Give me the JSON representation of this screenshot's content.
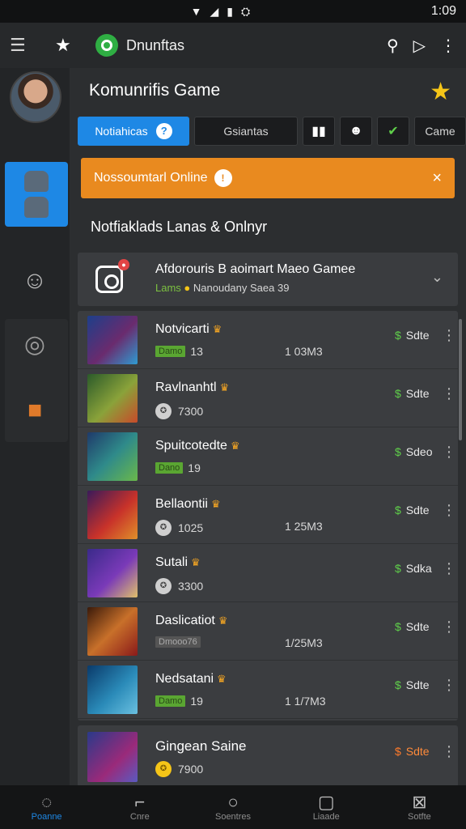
{
  "statusbar": {
    "time": "1:09"
  },
  "topbar": {
    "title": "Dnunftas"
  },
  "main": {
    "title": "Komunrifis Game",
    "tabs": [
      {
        "label": "Notiahicas"
      },
      {
        "label": "Gsiantas"
      },
      {
        "label": "Came"
      }
    ],
    "banner": {
      "text": "Nossoumtarl Online",
      "close": "×"
    },
    "section_title": "Notfiaklads Lanas & Onlnyr",
    "featured": {
      "title": "Afdorouris B aoimart Maeo Gamee",
      "sub_tag": "Lams",
      "sub_text": "Nanoudany Saea 39"
    },
    "games": [
      {
        "name": "Notvicarti",
        "tag": "Damo",
        "value": "13",
        "size": "1 03M3",
        "status": "Sdte",
        "thumb": "linear-gradient(135deg,#1d3f8a,#6a2b6e 55%,#2f9bd1)"
      },
      {
        "name": "Ravlnanhtl",
        "tag": "",
        "value": "7300",
        "size": "",
        "status": "Sdte",
        "thumb": "linear-gradient(135deg,#2b5a2a,#8aa23a 55%,#c84a2a)"
      },
      {
        "name": "Spuitcotedte",
        "tag": "Dano",
        "value": "19",
        "size": "",
        "status": "Sdeo",
        "thumb": "linear-gradient(135deg,#1f3a6a,#2f8a8a 50%,#6ab84a)"
      },
      {
        "name": "Bellaontii",
        "tag": "",
        "value": "1025",
        "size": "1 25M3",
        "status": "Sdte",
        "thumb": "linear-gradient(135deg,#3a1a5a,#c8322a 55%,#e0902a)"
      },
      {
        "name": "Sutali",
        "tag": "",
        "value": "3300",
        "size": "",
        "status": "Sdka",
        "thumb": "linear-gradient(135deg,#3a2a8a,#7a3ab8 55%,#e0c06a)"
      },
      {
        "name": "Daslicatiot",
        "tag": "Dmooo76",
        "value": "",
        "size": "1/25M3",
        "status": "Sdte",
        "thumb": "linear-gradient(135deg,#3a1a0a,#c8702a 50%,#8a1a1a)"
      },
      {
        "name": "Nedsatani",
        "tag": "Damo",
        "value": "19",
        "size": "1 1/7M3",
        "status": "Sdte",
        "thumb": "linear-gradient(135deg,#0a3a6a,#2a8ab8 55%,#6ac0e0)"
      }
    ],
    "last_game": {
      "name": "Gingean Saine",
      "value": "7900",
      "status": "Sdte"
    }
  },
  "bottom_nav": [
    {
      "label": "Poanne",
      "icon": "◌"
    },
    {
      "label": "Cnre",
      "icon": "⌐"
    },
    {
      "label": "Soentres",
      "icon": "○"
    },
    {
      "label": "Liaade",
      "icon": "▢"
    },
    {
      "label": "Sotfte",
      "icon": "⊠"
    }
  ],
  "colors": {
    "accent": "#1e88e5",
    "banner": "#e98a1f",
    "online": "#5fcf4a"
  }
}
